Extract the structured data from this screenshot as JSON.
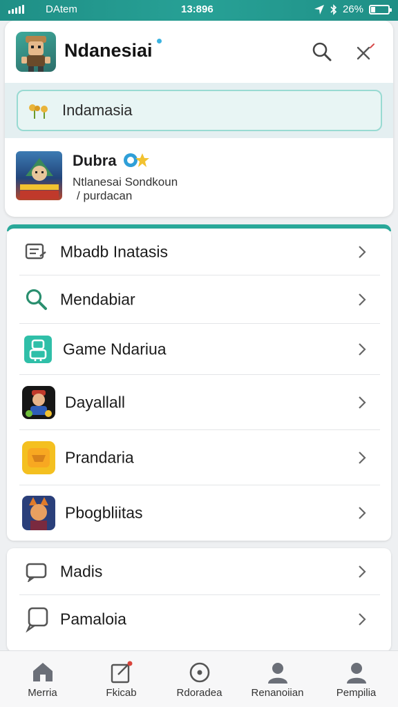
{
  "status_bar": {
    "carrier": "DAtem",
    "time": "13:896",
    "battery": "26%"
  },
  "header": {
    "app_name": "Ndanesiai"
  },
  "search": {
    "value": "Indamasia"
  },
  "featured_game": {
    "title": "Dubra",
    "line1": "Ntlanesai Sondkoun",
    "line2": "/ purdacan"
  },
  "menu": {
    "items": [
      {
        "label": "Mbadb Inatasis",
        "icon": "document-icon"
      },
      {
        "label": "Mendabiar",
        "icon": "search-icon"
      },
      {
        "label": "Game Ndariua",
        "icon": "robot-icon"
      },
      {
        "label": "Dayallall",
        "icon": "game-character-icon"
      },
      {
        "label": "Prandaria",
        "icon": "yellow-app-icon"
      },
      {
        "label": "Pbogbliitas",
        "icon": "fox-character-icon"
      }
    ]
  },
  "menu2": {
    "items": [
      {
        "label": "Madis",
        "icon": "message-icon"
      },
      {
        "label": "Pamaloia",
        "icon": "chat-bubble-icon"
      }
    ]
  },
  "tabs": [
    {
      "label": "Merria",
      "icon": "home-icon"
    },
    {
      "label": "Fkicab",
      "icon": "edit-icon"
    },
    {
      "label": "Rdoradea",
      "icon": "clock-icon"
    },
    {
      "label": "Renanoiian",
      "icon": "person-icon"
    },
    {
      "label": "Pempilia",
      "icon": "profile-icon"
    }
  ],
  "colors": {
    "teal": "#27a196",
    "search_border": "#98dad2",
    "tab_bg": "#f7f7f8"
  }
}
